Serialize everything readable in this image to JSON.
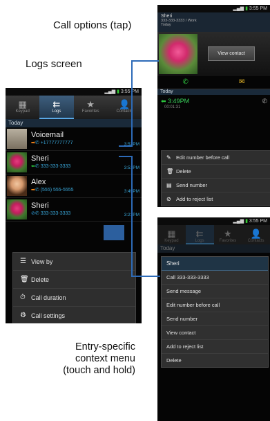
{
  "captions": {
    "call_options": "Call options (tap)",
    "logs": "Logs screen",
    "context_line1": "Entry-specific",
    "context_line2": "context menu",
    "context_line3": "(touch and hold)"
  },
  "status_bar": {
    "time": "3:55 PM"
  },
  "logs_screen": {
    "tabs": [
      {
        "label": "Keypad",
        "icon": "keypad-icon",
        "glyph": "▦"
      },
      {
        "label": "Logs",
        "icon": "logs-icon",
        "glyph": "⇇"
      },
      {
        "label": "Favorites",
        "icon": "star-icon",
        "glyph": "★"
      },
      {
        "label": "Contacts",
        "icon": "contact-icon",
        "glyph": "👤"
      }
    ],
    "section": "Today",
    "entries": [
      {
        "name": "Voicemail",
        "number": "+17777777777",
        "time": "3:52PM",
        "direction": "outgoing"
      },
      {
        "name": "Sheri",
        "number": "333-333-3333",
        "time": "3:51PM",
        "direction": "incoming"
      },
      {
        "name": "Alex",
        "number": "(555) 555-5555",
        "time": "3:49PM",
        "direction": "outgoing"
      },
      {
        "name": "Sheri",
        "number": "333-333-3333",
        "time": "3:21PM",
        "direction": "missed"
      }
    ],
    "menu": [
      {
        "label": "View by",
        "icon": "list-icon",
        "glyph": "☰"
      },
      {
        "label": "Delete",
        "icon": "trash-icon",
        "glyph": "🗑"
      },
      {
        "label": "Call duration",
        "icon": "clock-icon",
        "glyph": "⏱"
      },
      {
        "label": "Call settings",
        "icon": "gear-icon",
        "glyph": "⚙"
      }
    ]
  },
  "call_options_screen": {
    "contact_name": "Sheri",
    "contact_sub": "333-333-3333 / Work",
    "contact_sub2": "Today",
    "view_contact": "View contact",
    "section": "Today",
    "call_time": "3:49PM",
    "call_duration": "00:01:31",
    "menu": [
      {
        "label": "Edit number before call",
        "icon": "pencil-icon",
        "glyph": "✎"
      },
      {
        "label": "Delete",
        "icon": "trash-icon",
        "glyph": "🗑"
      },
      {
        "label": "Send number",
        "icon": "send-number-icon",
        "glyph": "▤"
      },
      {
        "label": "Add to reject list",
        "icon": "reject-list-icon",
        "glyph": "⊘"
      }
    ]
  },
  "context_screen": {
    "tabs": [
      {
        "label": "Keypad",
        "icon": "keypad-icon",
        "glyph": "▦"
      },
      {
        "label": "Logs",
        "icon": "logs-icon",
        "glyph": "⇇"
      },
      {
        "label": "Favorites",
        "icon": "star-icon",
        "glyph": "★"
      },
      {
        "label": "Contacts",
        "icon": "contact-icon",
        "glyph": "👤"
      }
    ],
    "section": "Today",
    "menu_title": "Sheri",
    "menu": [
      "Call 333-333-3333",
      "Send message",
      "Edit number before call",
      "Send number",
      "View contact",
      "Add to reject list",
      "Delete"
    ]
  },
  "colors": {
    "accent": "#2d6bb8",
    "number_blue": "#39a6d8",
    "incoming_green": "#2ecc40",
    "outgoing_orange": "#ff8a1a"
  }
}
